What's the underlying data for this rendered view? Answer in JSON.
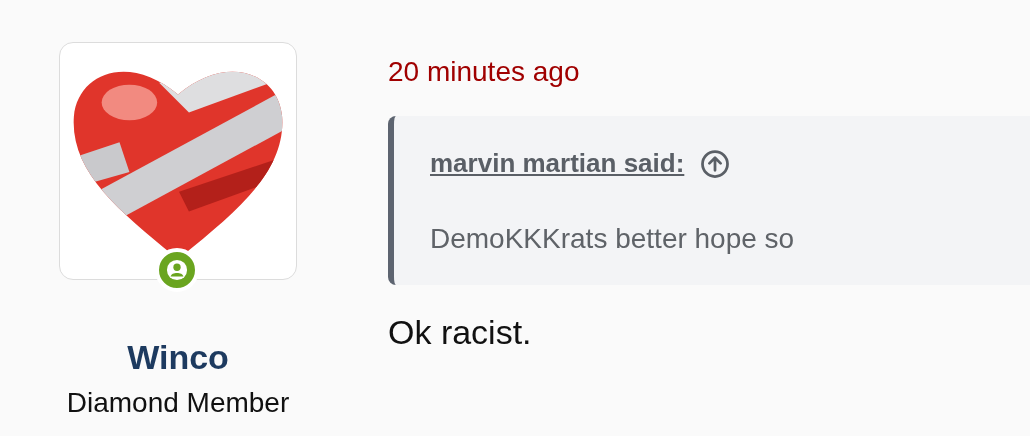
{
  "poster": {
    "name": "Winco",
    "title": "Diamond Member",
    "online": true
  },
  "post": {
    "time": "20 minutes ago",
    "quote": {
      "attribution": "marvin martian said:",
      "text": "DemoKKKrats better hope so"
    },
    "body": "Ok racist."
  }
}
